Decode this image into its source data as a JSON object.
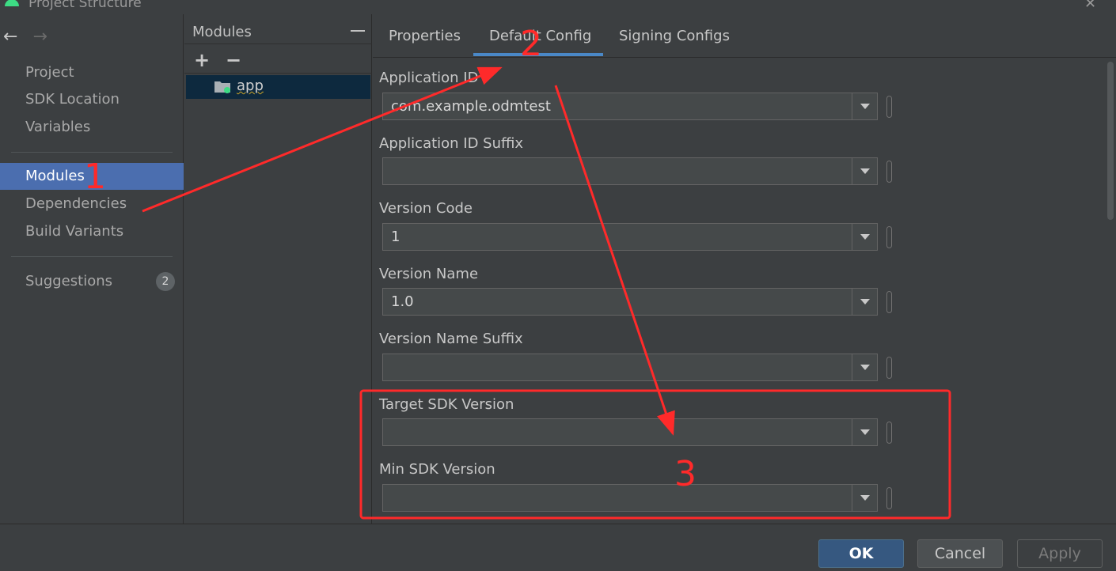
{
  "window": {
    "title": "Project Structure",
    "close_glyph": "✕"
  },
  "nav": {
    "back_glyph": "←",
    "forward_glyph": "→",
    "items": [
      {
        "label": "Project"
      },
      {
        "label": "SDK Location"
      },
      {
        "label": "Variables"
      },
      {
        "label": "Modules",
        "active": true
      },
      {
        "label": "Dependencies"
      },
      {
        "label": "Build Variants"
      },
      {
        "label": "Suggestions",
        "badge": "2"
      }
    ]
  },
  "modules": {
    "header": "Modules",
    "add_glyph": "+",
    "remove_glyph": "−",
    "list": [
      {
        "name": "app"
      }
    ]
  },
  "tabs": [
    {
      "label": "Properties"
    },
    {
      "label": "Default Config",
      "active": true
    },
    {
      "label": "Signing Configs"
    }
  ],
  "fields": [
    {
      "label": "Application ID",
      "value": "com.example.odmtest"
    },
    {
      "label": "Application ID Suffix",
      "value": ""
    },
    {
      "label": "Version Code",
      "value": "1"
    },
    {
      "label": "Version Name",
      "value": "1.0"
    },
    {
      "label": "Version Name Suffix",
      "value": ""
    },
    {
      "label": "Target SDK Version",
      "value": ""
    },
    {
      "label": "Min SDK Version",
      "value": ""
    }
  ],
  "footer": {
    "ok": "OK",
    "cancel": "Cancel",
    "apply": "Apply"
  },
  "annotations": {
    "one": "1",
    "two": "2",
    "three": "3"
  },
  "colors": {
    "accent": "#4b6eaf",
    "annotation": "#ff2a2a"
  }
}
